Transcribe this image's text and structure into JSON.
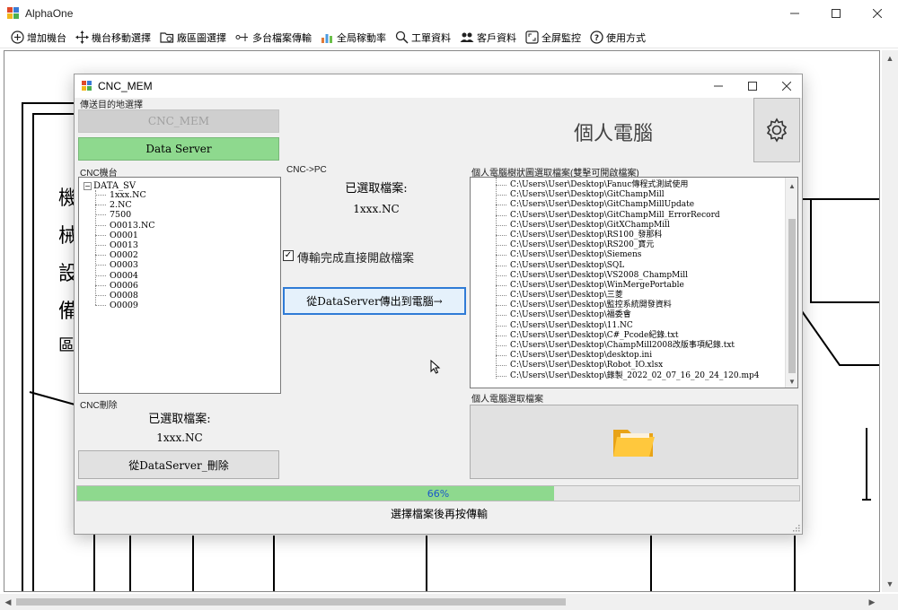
{
  "app": {
    "title": "AlphaOne"
  },
  "toolbar": {
    "items": [
      {
        "label": "增加機台",
        "icon": "add-circle-icon"
      },
      {
        "label": "機台移動選擇",
        "icon": "move-arrows-icon"
      },
      {
        "label": "廠區圖選擇",
        "icon": "folder-settings-icon"
      },
      {
        "label": "多台檔案傳輸",
        "icon": "network-transfer-icon"
      },
      {
        "label": "全局稼動率",
        "icon": "bar-chart-icon"
      },
      {
        "label": "工單資料",
        "icon": "search-icon"
      },
      {
        "label": "客戶資料",
        "icon": "users-icon"
      },
      {
        "label": "全屏監控",
        "icon": "fullscreen-icon"
      },
      {
        "label": "使用方式",
        "icon": "help-icon"
      }
    ]
  },
  "drawing": {
    "vertical_chars": [
      "機",
      "械",
      "設",
      "備",
      "區"
    ]
  },
  "dialog": {
    "title": "CNC_MEM",
    "destination": {
      "label": "傳送目的地選擇",
      "cnc_mem_button": "CNC_MEM",
      "data_server_button": "Data Server"
    },
    "pc_title": "個人電腦",
    "cnc_machine": {
      "label": "CNC機台",
      "root": "DATA_SV",
      "root_expander": "−",
      "files": [
        "1xxx.NC",
        "2.NC",
        "7500",
        "O0013.NC",
        "O0001",
        "O0013",
        "O0002",
        "O0003",
        "O0004",
        "O0006",
        "O0008",
        "O0009"
      ]
    },
    "transfer": {
      "label": "CNC->PC",
      "selected_label": "已選取檔案:",
      "selected_file": "1xxx.NC",
      "checkbox_label": "傳輸完成直接開啟檔案",
      "checkbox_checked": true,
      "checkbox_mark": "✓",
      "transfer_button": "從DataServer傳出到電腦→"
    },
    "pc_tree": {
      "label": "個人電腦樹狀圖選取檔案(雙擊可開啟檔案)",
      "files": [
        "C:\\Users\\User\\Desktop\\Fanuc傳程式測試使用",
        "C:\\Users\\User\\Desktop\\GitChampMill",
        "C:\\Users\\User\\Desktop\\GitChampMillUpdate",
        "C:\\Users\\User\\Desktop\\GitChampMill_ErrorRecord",
        "C:\\Users\\User\\Desktop\\GitXChampMill",
        "C:\\Users\\User\\Desktop\\RS100_發那科",
        "C:\\Users\\User\\Desktop\\RS200_寶元",
        "C:\\Users\\User\\Desktop\\Siemens",
        "C:\\Users\\User\\Desktop\\SQL",
        "C:\\Users\\User\\Desktop\\VS2008_ChampMill",
        "C:\\Users\\User\\Desktop\\WinMergePortable",
        "C:\\Users\\User\\Desktop\\三菱",
        "C:\\Users\\User\\Desktop\\監控系統開發資料",
        "C:\\Users\\User\\Desktop\\福委會",
        "C:\\Users\\User\\Desktop\\11.NC",
        "C:\\Users\\User\\Desktop\\C#_Pcode紀錄.txt",
        "C:\\Users\\User\\Desktop\\ChampMill2008改版事項紀錄.txt",
        "C:\\Users\\User\\Desktop\\desktop.ini",
        "C:\\Users\\User\\Desktop\\Robot_IO.xlsx",
        "C:\\Users\\User\\Desktop\\錄製_2022_02_07_16_20_24_120.mp4"
      ]
    },
    "cnc_delete": {
      "label": "CNC刪除",
      "selected_label": "已選取檔案:",
      "selected_file": "1xxx.NC",
      "delete_button": "從DataServer_刪除"
    },
    "pc_select": {
      "label": "個人電腦選取檔案"
    },
    "progress": {
      "value": 66,
      "text": "66%"
    },
    "status": "選擇檔案後再按傳輸"
  }
}
